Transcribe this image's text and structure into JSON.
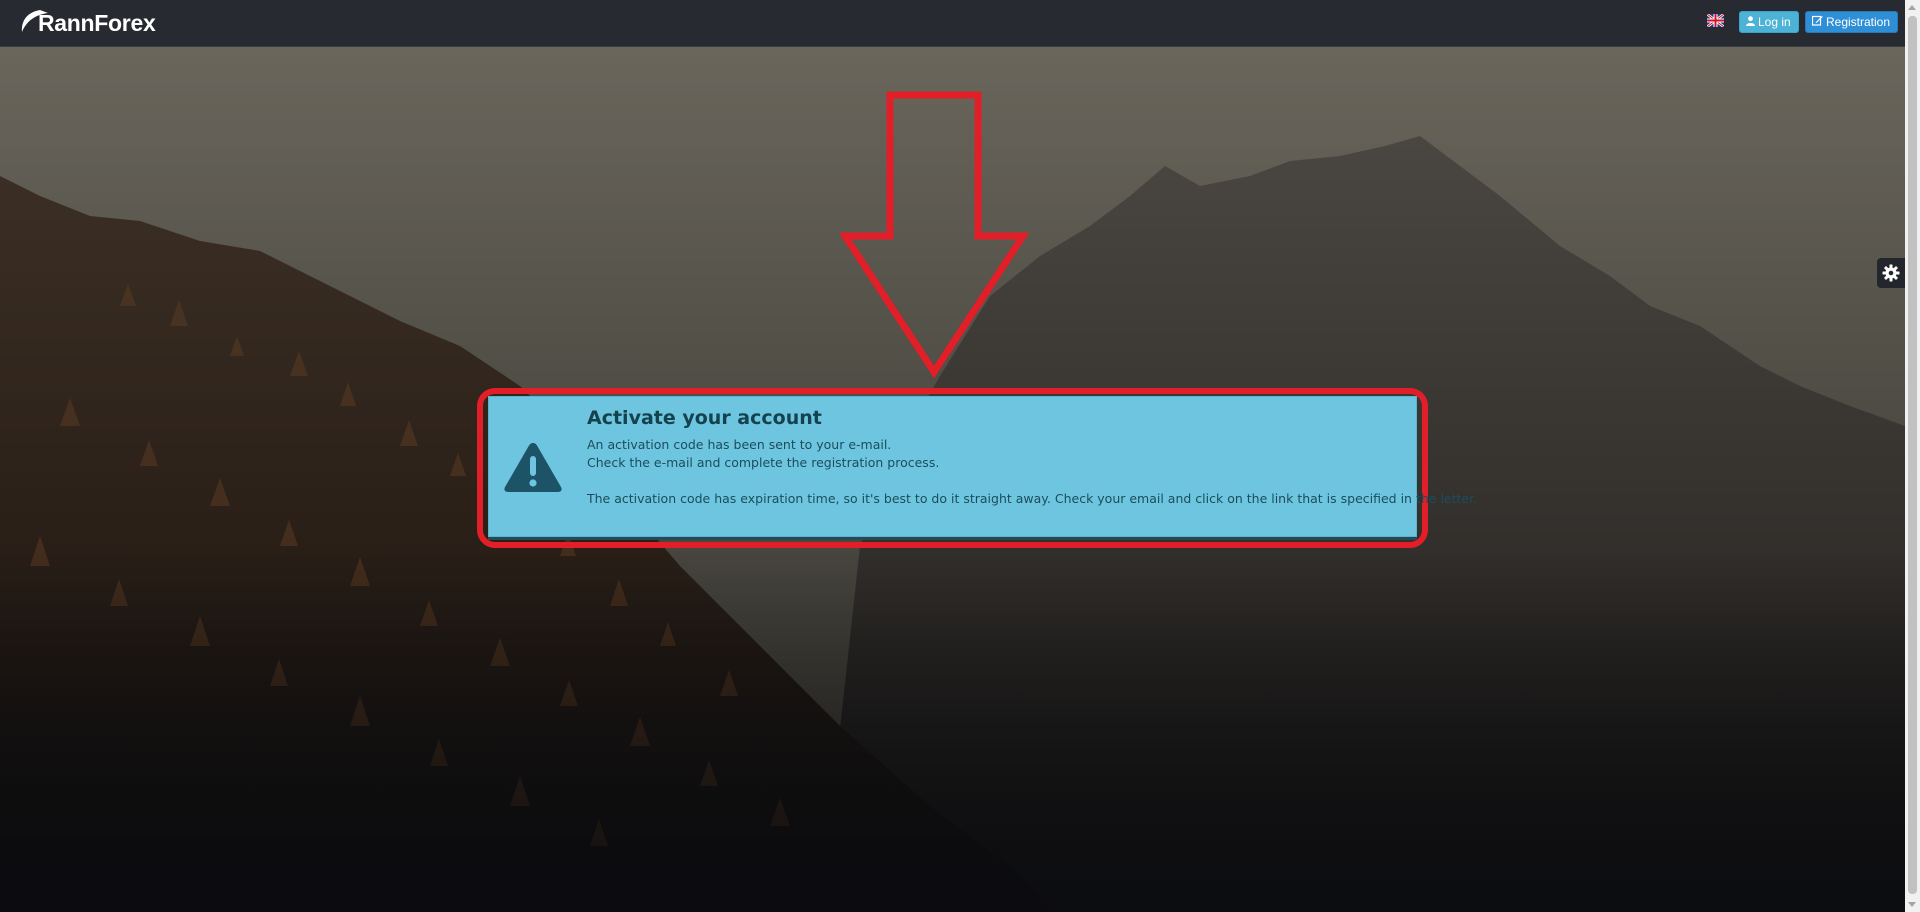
{
  "header": {
    "logo_text": "RannForex",
    "language_icon": "uk-flag-icon",
    "login_label": "Log in",
    "registration_label": "Registration"
  },
  "alert": {
    "title": "Activate your account",
    "line1": "An activation code has been sent to your e-mail.",
    "line2": "Check the e-mail and complete the registration process.",
    "line3": "The activation code has expiration time, so it's best to do it straight away. Check your email and click on the link that is specified in the letter.",
    "icon": "warning-triangle-icon"
  },
  "colors": {
    "topbar": "#272b31",
    "alert_bg": "#6ec5df",
    "highlight_red": "#e21e28",
    "login_button": "#4cb2d6",
    "registration_button": "#2f8fd6"
  }
}
